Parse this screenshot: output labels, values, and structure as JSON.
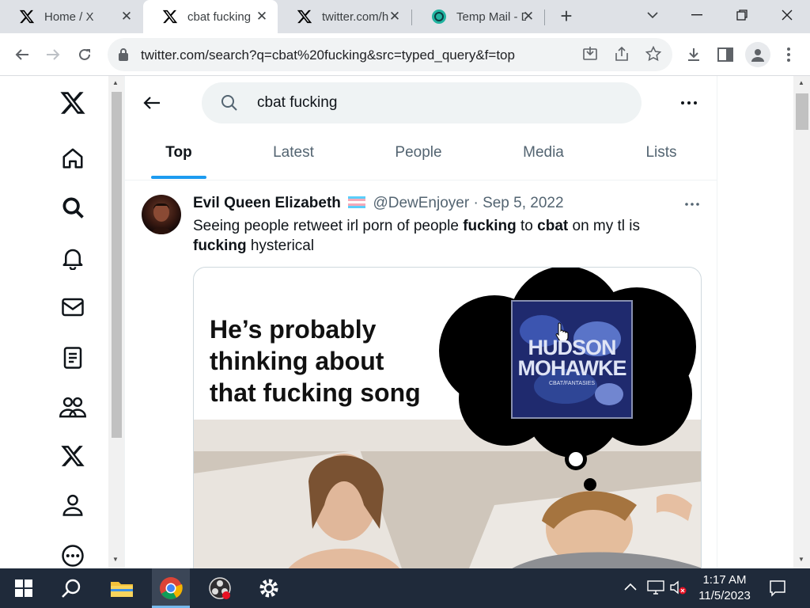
{
  "browser": {
    "tabs": [
      {
        "title": "Home / X",
        "icon": "x-logo-icon"
      },
      {
        "title": "cbat fucking",
        "icon": "x-logo-icon"
      },
      {
        "title": "twitter.com/h",
        "icon": "x-logo-icon"
      },
      {
        "title": "Temp Mail - D",
        "icon": "temp-mail-icon"
      }
    ],
    "new_tab": "+",
    "url": "twitter.com/search?q=cbat%20fucking&src=typed_query&f=top"
  },
  "search": {
    "query": "cbat fucking",
    "tabs": [
      "Top",
      "Latest",
      "People",
      "Media",
      "Lists"
    ],
    "selected_tab": "Top"
  },
  "tweet": {
    "author": "Evil Queen Elizabeth",
    "handle": "@DewEnjoyer",
    "sep": "·",
    "date": "Sep 5, 2022",
    "body": [
      {
        "t": "Seeing people retweet irl porn of people ",
        "b": false
      },
      {
        "t": "fucking",
        "b": true
      },
      {
        "t": " to ",
        "b": false
      },
      {
        "t": "cbat",
        "b": true
      },
      {
        "t": " on my tl is ",
        "b": false
      },
      {
        "t": "fucking",
        "b": true
      },
      {
        "t": " hysterical",
        "b": false
      }
    ],
    "meme_caption": [
      "He’s probably",
      "thinking about",
      "that fucking song"
    ],
    "album_text": [
      "HUDSON",
      "MOHAWKE",
      "CBAT/FANTASIES"
    ]
  },
  "taskbar": {
    "time": "1:17 AM",
    "date": "11/5/2023"
  },
  "colors": {
    "accent": "#1d9bf0",
    "taskbar": "#1f2a3a"
  }
}
